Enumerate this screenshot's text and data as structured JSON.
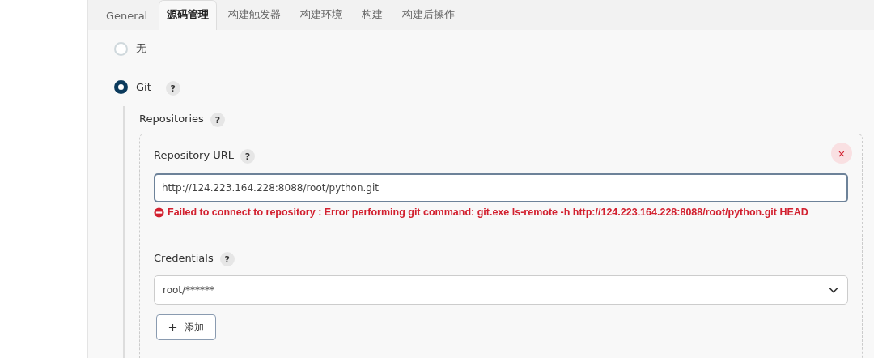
{
  "tabs": [
    {
      "label": "General",
      "selected": false
    },
    {
      "label": "源码管理",
      "selected": true
    },
    {
      "label": "构建触发器",
      "selected": false
    },
    {
      "label": "构建环境",
      "selected": false
    },
    {
      "label": "构建",
      "selected": false
    },
    {
      "label": "构建后操作",
      "selected": false
    }
  ],
  "scm_options": [
    {
      "label": "无",
      "selected": false
    },
    {
      "label": "Git",
      "selected": true,
      "help": "?"
    }
  ],
  "repositories": {
    "label": "Repositories",
    "help": "?",
    "repository_url": {
      "label": "Repository URL",
      "help": "?",
      "value": "http://124.223.164.228:8088/root/python.git",
      "error": "Failed to connect to repository : Error performing git command: git.exe ls-remote -h http://124.223.164.228:8088/root/python.git HEAD"
    },
    "remove": "×",
    "credentials": {
      "label": "Credentials",
      "help": "?",
      "value": "root/******"
    },
    "add_button": "添加"
  }
}
